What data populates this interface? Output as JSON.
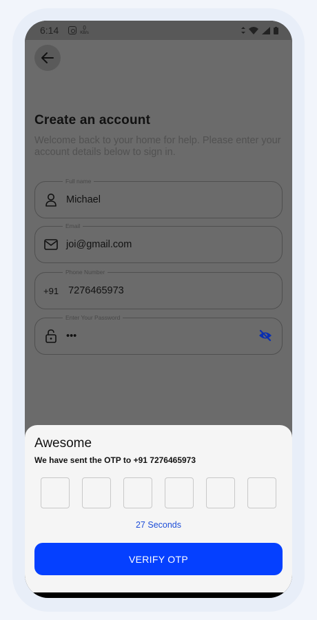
{
  "status_bar": {
    "time": "6:14",
    "speed_value": "0",
    "speed_unit": "KB/s",
    "icons": [
      "instagram-icon",
      "data-arrows-icon",
      "wifi-icon",
      "signal-icon",
      "battery-icon"
    ]
  },
  "header": {
    "back_icon": "arrow-left-icon"
  },
  "page": {
    "title": "Create an account",
    "subtitle": "Welcome back to your home for help. Please enter your account details below to sign in."
  },
  "form": {
    "full_name": {
      "label": "Full name",
      "value": "Michael",
      "icon": "user-icon"
    },
    "email": {
      "label": "Email",
      "value": "joi@gmail.com",
      "icon": "mail-icon"
    },
    "phone": {
      "label": "Phone Number",
      "prefix": "+91",
      "value": "7276465973"
    },
    "password": {
      "label": "Enter Your Password",
      "value": "•••",
      "icon": "lock-icon",
      "toggle_icon": "eye-off-icon"
    }
  },
  "otp_sheet": {
    "title": "Awesome",
    "message": "We have sent the OTP to +91 7276465973",
    "digits": [
      "",
      "",
      "",
      "",
      "",
      ""
    ],
    "timer": "27 Seconds",
    "verify_label": "VERIFY OTP"
  },
  "colors": {
    "accent": "#0540ff",
    "timer": "#1e4ed8",
    "overlay": "#6b6b6b",
    "sheet": "#f5f5f5"
  }
}
